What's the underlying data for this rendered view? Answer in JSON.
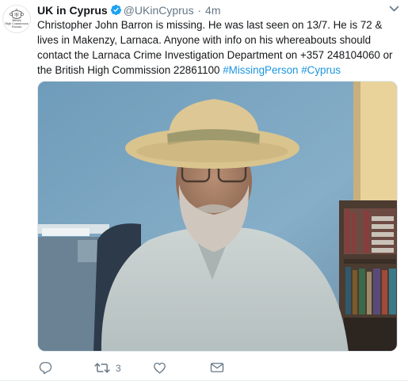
{
  "tweet": {
    "author": {
      "display_name": "UK in Cyprus",
      "handle": "@UKinCyprus",
      "verified": true,
      "avatar_caption": [
        "British",
        "High Commission",
        "Nicosia"
      ]
    },
    "separator": "·",
    "timestamp": "4m",
    "text_segments": [
      "Christopher John Barron is missing. He was last seen on 13/7. He is 72 & lives in Makenzy, Larnaca. Anyone with info on his whereabouts should contact the Larnaca Crime Investigation Department on +357 248104060 or the British High Commission 22861100 "
    ],
    "hashtags": [
      "#MissingPerson",
      "#Cyprus"
    ],
    "media": {
      "description": "photo-of-missing-person"
    },
    "actions": {
      "reply_icon": "reply-icon",
      "retweet_icon": "retweet-icon",
      "retweet_count": "3",
      "like_icon": "heart-icon",
      "message_icon": "envelope-icon"
    },
    "colors": {
      "link": "#1b95e0",
      "text": "#14171a",
      "secondary": "#657786",
      "verified": "#1da1f2"
    }
  }
}
